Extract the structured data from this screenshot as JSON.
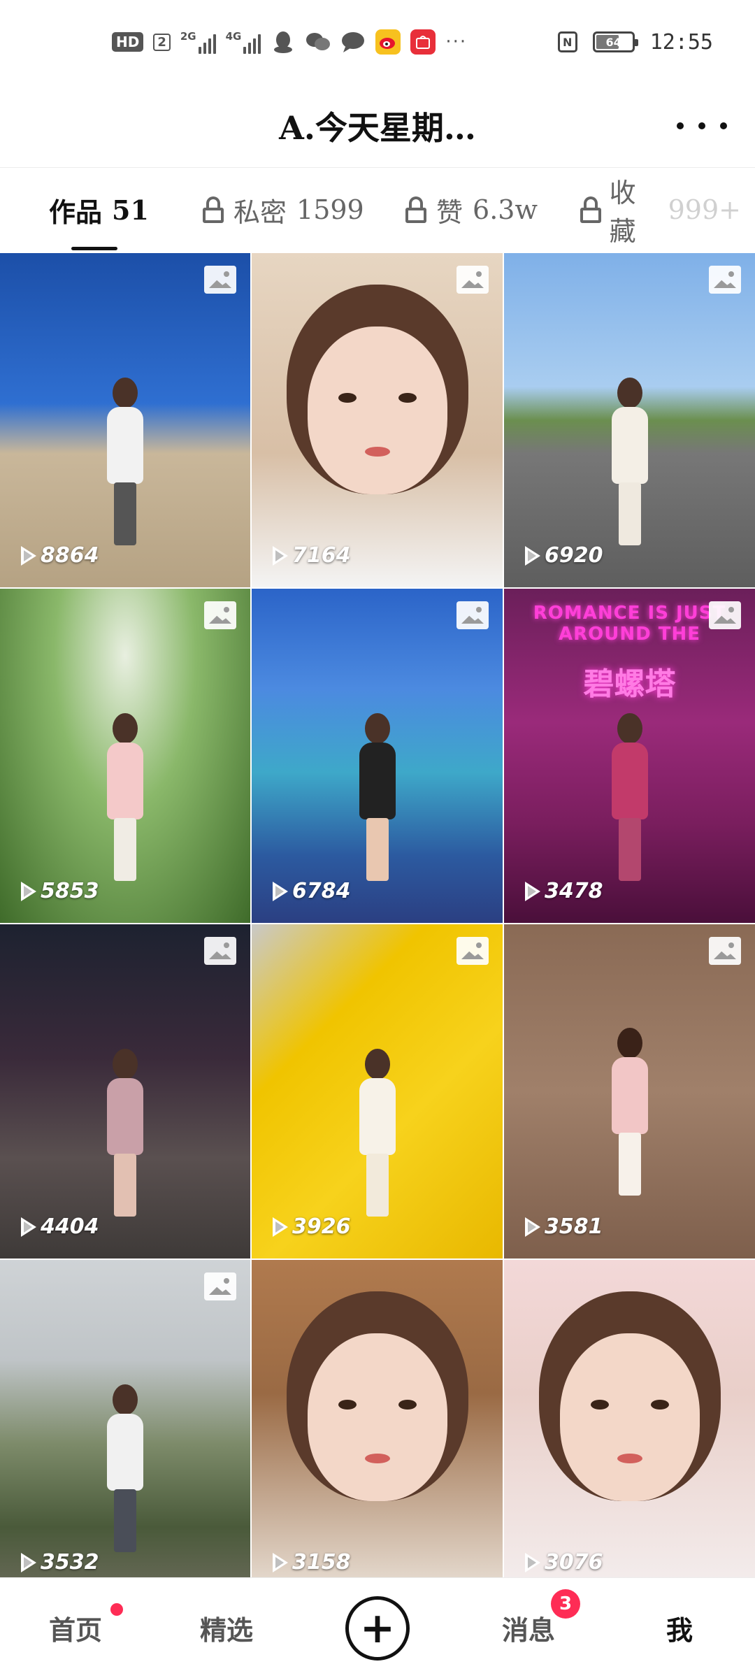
{
  "status_bar": {
    "hd": "HD",
    "sim": "2",
    "net1": "2G",
    "net2": "4G",
    "battery": "64",
    "battery_level": 0.64,
    "time": "12:55",
    "more": "···",
    "icons": [
      "qq-icon",
      "wechat-icon",
      "message-icon",
      "weibo-icon",
      "huawei-icon"
    ]
  },
  "header": {
    "title": "A.今天星期…",
    "more_label": "more-options"
  },
  "tabs": [
    {
      "label": "作品",
      "count": "51",
      "locked": false,
      "active": true
    },
    {
      "label": "私密",
      "count": "1599",
      "locked": true,
      "active": false
    },
    {
      "label": "赞",
      "count": "6.3w",
      "locked": true,
      "active": false
    },
    {
      "label": "收藏",
      "count": "999+",
      "locked": true,
      "active": false
    }
  ],
  "videos": [
    {
      "plays": "8864",
      "has_photo_icon": true
    },
    {
      "plays": "7164",
      "has_photo_icon": true
    },
    {
      "plays": "6920",
      "has_photo_icon": true
    },
    {
      "plays": "5853",
      "has_photo_icon": true
    },
    {
      "plays": "6784",
      "has_photo_icon": true
    },
    {
      "plays": "3478",
      "has_photo_icon": true,
      "neon_text": "ROMANCE IS JUST AROUND THE",
      "neon_sign": "碧螺塔"
    },
    {
      "plays": "4404",
      "has_photo_icon": true
    },
    {
      "plays": "3926",
      "has_photo_icon": true
    },
    {
      "plays": "3581",
      "has_photo_icon": true
    },
    {
      "plays": "3532",
      "has_photo_icon": true
    },
    {
      "plays": "3158",
      "has_photo_icon": false
    },
    {
      "plays": "3076",
      "has_photo_icon": false
    }
  ],
  "bottom_nav": {
    "home": "首页",
    "featured": "精选",
    "add": "+",
    "messages": "消息",
    "messages_badge": "3",
    "me": "我"
  },
  "colors": {
    "accent_red": "#fe2c55",
    "text_primary": "#111111",
    "text_secondary": "#666666"
  }
}
